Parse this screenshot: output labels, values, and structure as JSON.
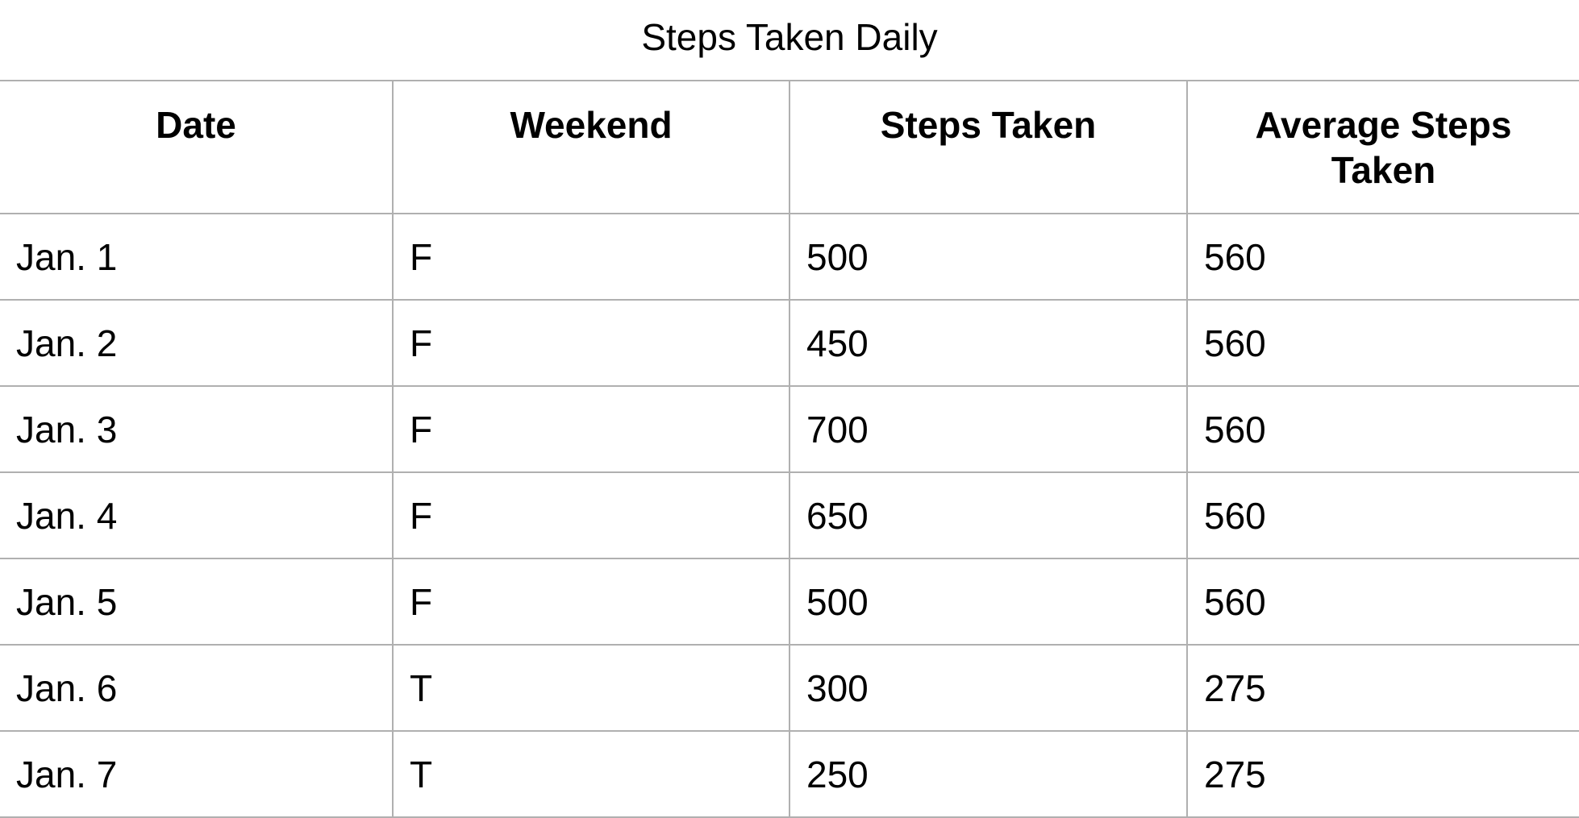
{
  "title": "Steps Taken Daily",
  "columns": [
    "Date",
    "Weekend",
    "Steps Taken",
    "Average Steps Taken"
  ],
  "rows": [
    [
      "Jan. 1",
      "F",
      "500",
      "560"
    ],
    [
      "Jan. 2",
      "F",
      "450",
      "560"
    ],
    [
      "Jan. 3",
      "F",
      "700",
      "560"
    ],
    [
      "Jan. 4",
      "F",
      "650",
      "560"
    ],
    [
      "Jan. 5",
      "F",
      "500",
      "560"
    ],
    [
      "Jan. 6",
      "T",
      "300",
      "275"
    ],
    [
      "Jan. 7",
      "T",
      "250",
      "275"
    ]
  ],
  "colors": {
    "border": "#b0b0b0",
    "text": "#000000",
    "background": "#ffffff"
  }
}
